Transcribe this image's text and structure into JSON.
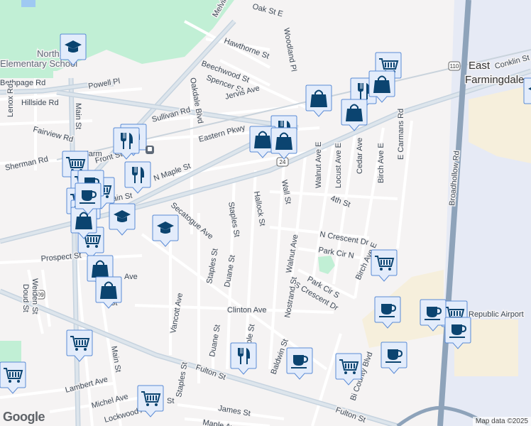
{
  "map": {
    "street_labels": [
      "Melville Rd",
      "Oak St E",
      "Woodland Pl",
      "Hawthorne St",
      "Beechwood St",
      "Spencer St",
      "Jervis Ave",
      "Northside",
      "Elementary School",
      "Powell Pl",
      "Bethpage Rd",
      "Hillside Rd",
      "Lenox Rd",
      "Main St",
      "Fairview Rd",
      "Oakdale Blvd",
      "Sullivan Rd",
      "Eastern Pkwy",
      "Sherman Rd",
      "Front St",
      "N Maple St",
      "Main St",
      "Secatogue Ave",
      "Staples St",
      "Hallock St",
      "Wall St",
      "Walnut Ave E",
      "Locust Ave E",
      "Cedar Ave",
      "Birch Ave E",
      "E Carmans Rd",
      "4th St",
      "N Crescent Dr",
      "Park Cir N",
      "Walnut Ave",
      "Park Cir S",
      "Birch Ave E",
      "S Crescent Dr",
      "Prospect St",
      "Weiden St",
      "Doud St",
      "Ave",
      "Clinton Ave",
      "Duane St",
      "Duane St",
      "Vancott Ave",
      "Staples St",
      "Nostrand St",
      "Baldwin St",
      "Maple St",
      "Bi County Blvd",
      "Fulton St",
      "Fulton St",
      "Main St",
      "Lambert Ave",
      "Michel Ave",
      "Lockwood Ave",
      "James St",
      "Maple Ave",
      "Staples St",
      "Broadhollow Rd",
      "Republic Airport",
      "East",
      "Farmingdale",
      "Conklin St",
      "Farm",
      "Farm",
      "Ave",
      "St",
      "St"
    ],
    "shields": [
      "110",
      "24",
      "109"
    ],
    "markers": [
      "school",
      "school",
      "school",
      "school",
      "restaurant",
      "restaurant",
      "restaurant",
      "restaurant",
      "restaurant",
      "restaurant",
      "grocery",
      "grocery",
      "grocery",
      "grocery",
      "grocery",
      "grocery",
      "grocery",
      "grocery",
      "grocery",
      "grocery",
      "grocery",
      "grocery",
      "grocery",
      "grocery",
      "store",
      "store",
      "store",
      "store",
      "store",
      "store",
      "store",
      "store",
      "cafe",
      "cafe",
      "cafe",
      "cafe",
      "cafe",
      "cafe",
      "cafe"
    ],
    "attribution": "Map data ©2025",
    "logo": "Google"
  },
  "colors": {
    "park": "#c1efd5",
    "industrial": "#f6efdc",
    "airport": "#e6eaf5",
    "road": "#ffffff",
    "arterial": "#c6d3df",
    "highway": "#8ea3ba",
    "marker_bg": "#e3ecfb",
    "marker_border": "#5a8bd6",
    "icon": "#0b4470"
  }
}
